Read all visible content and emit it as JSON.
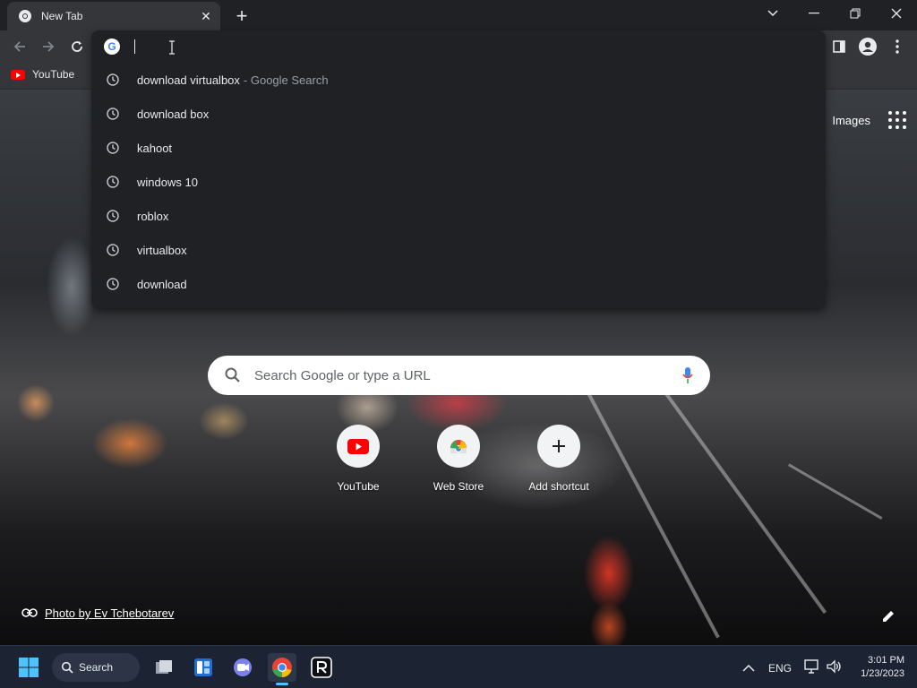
{
  "browser": {
    "tab_title": "New Tab",
    "bookmarks": [
      {
        "label": "YouTube"
      }
    ]
  },
  "omnibox": {
    "input_value": "",
    "suggestions": [
      {
        "text": "download virtualbox",
        "desc": "- Google Search"
      },
      {
        "text": "download box",
        "desc": ""
      },
      {
        "text": "kahoot",
        "desc": ""
      },
      {
        "text": "windows 10",
        "desc": ""
      },
      {
        "text": "roblox",
        "desc": ""
      },
      {
        "text": "virtualbox",
        "desc": ""
      },
      {
        "text": "download",
        "desc": ""
      }
    ]
  },
  "ntp": {
    "images_link": "Images",
    "search_placeholder": "Search Google or type a URL",
    "shortcuts": [
      {
        "label": "YouTube",
        "icon": "youtube-icon"
      },
      {
        "label": "Web Store",
        "icon": "web-store-icon"
      },
      {
        "label": "Add shortcut",
        "icon": "plus-icon"
      }
    ],
    "photo_credit": "Photo by Ev Tchebotarev"
  },
  "taskbar": {
    "search_label": "Search",
    "language": "ENG",
    "time": "3:01 PM",
    "date": "1/23/2023"
  },
  "colors": {
    "toolbar": "#35363a",
    "omnibox_bg": "#202124",
    "taskbar": "#1c2433",
    "accent_youtube": "#ff0000"
  }
}
